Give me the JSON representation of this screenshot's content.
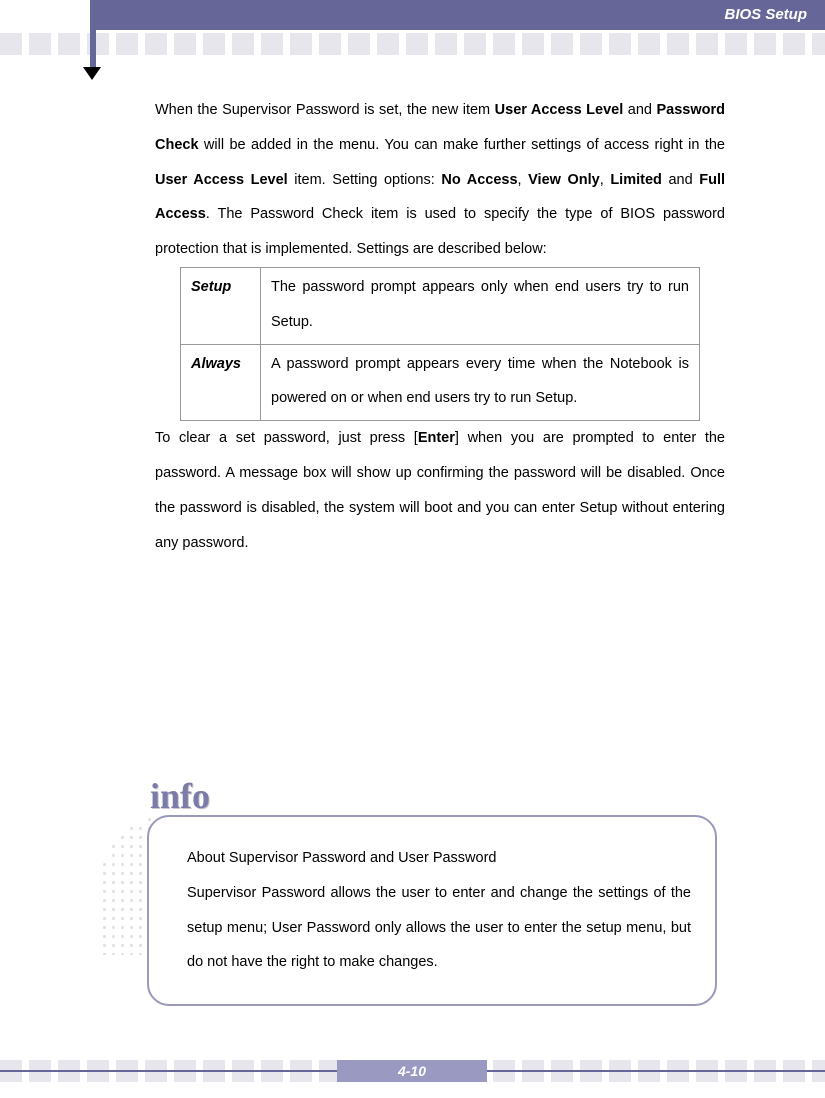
{
  "header": {
    "title": "BIOS Setup"
  },
  "body": {
    "p1_a": "When the Supervisor Password is set, the new item ",
    "p1_b": "User Access Level",
    "p1_c": " and ",
    "p1_d": "Password Check",
    "p1_e": " will be added in the menu.   You can make further settings of access right in the ",
    "p1_f": "User Access Level",
    "p1_g": " item.   Setting options: ",
    "p1_h": "No Access",
    "p1_i": ", ",
    "p1_j": "View Only",
    "p1_k": ", ",
    "p1_l": "Limited",
    "p1_m": " and ",
    "p1_n": "Full Access",
    "p1_o": ".   The Password Check item is used to specify the type of BIOS password protection that is implemented.   Settings are described below:",
    "table": {
      "r1h": "Setup",
      "r1d": "The password prompt appears only when end users try to run Setup.",
      "r2h": "Always",
      "r2d": "A password prompt appears every time when the Notebook is powered on or when end users try to run Setup."
    },
    "p2_a": "To clear a set password, just press [",
    "p2_b": "Enter",
    "p2_c": "] when you are prompted to enter the password.   A message box will show up confirming the password will be disabled.   Once the password is disabled, the system will boot and you can enter Setup without entering any password."
  },
  "info": {
    "label": "info",
    "line1": "About Supervisor Password and User Password",
    "line2": "Supervisor Password allows the user to enter and change the settings of the setup menu; User Password only allows the user to enter the setup menu, but do not have the right to make changes."
  },
  "footer": {
    "page": "4-10"
  }
}
